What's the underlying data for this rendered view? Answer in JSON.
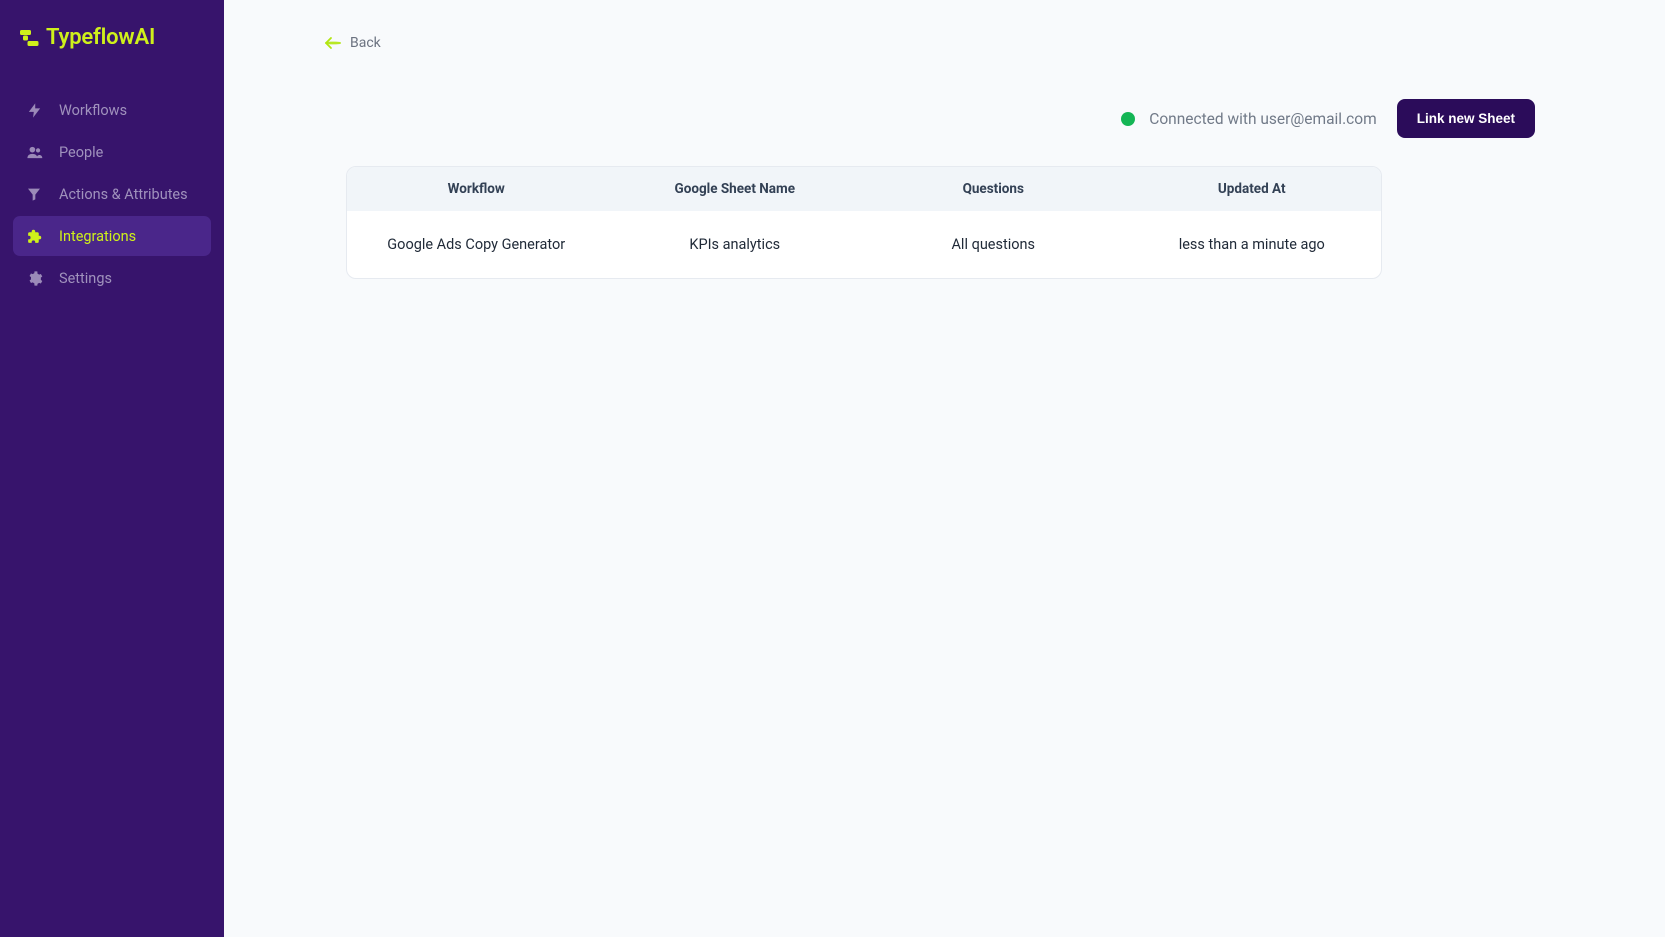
{
  "brand": {
    "name": "TypeflowAI"
  },
  "sidebar": {
    "items": [
      {
        "label": "Workflows",
        "icon": "lightning-icon",
        "active": false
      },
      {
        "label": "People",
        "icon": "people-icon",
        "active": false
      },
      {
        "label": "Actions & Attributes",
        "icon": "funnel-icon",
        "active": false
      },
      {
        "label": "Integrations",
        "icon": "puzzle-icon",
        "active": true
      },
      {
        "label": "Settings",
        "icon": "gear-icon",
        "active": false
      }
    ]
  },
  "back": {
    "label": "Back"
  },
  "status": {
    "text": "Connected with user@email.com"
  },
  "button": {
    "link_sheet": "Link new Sheet"
  },
  "table": {
    "headers": {
      "workflow": "Workflow",
      "sheet_name": "Google Sheet Name",
      "questions": "Questions",
      "updated_at": "Updated At"
    },
    "rows": [
      {
        "workflow": "Google Ads Copy Generator",
        "sheet_name": "KPIs analytics",
        "questions": "All questions",
        "updated_at": "less than a minute ago"
      }
    ]
  }
}
